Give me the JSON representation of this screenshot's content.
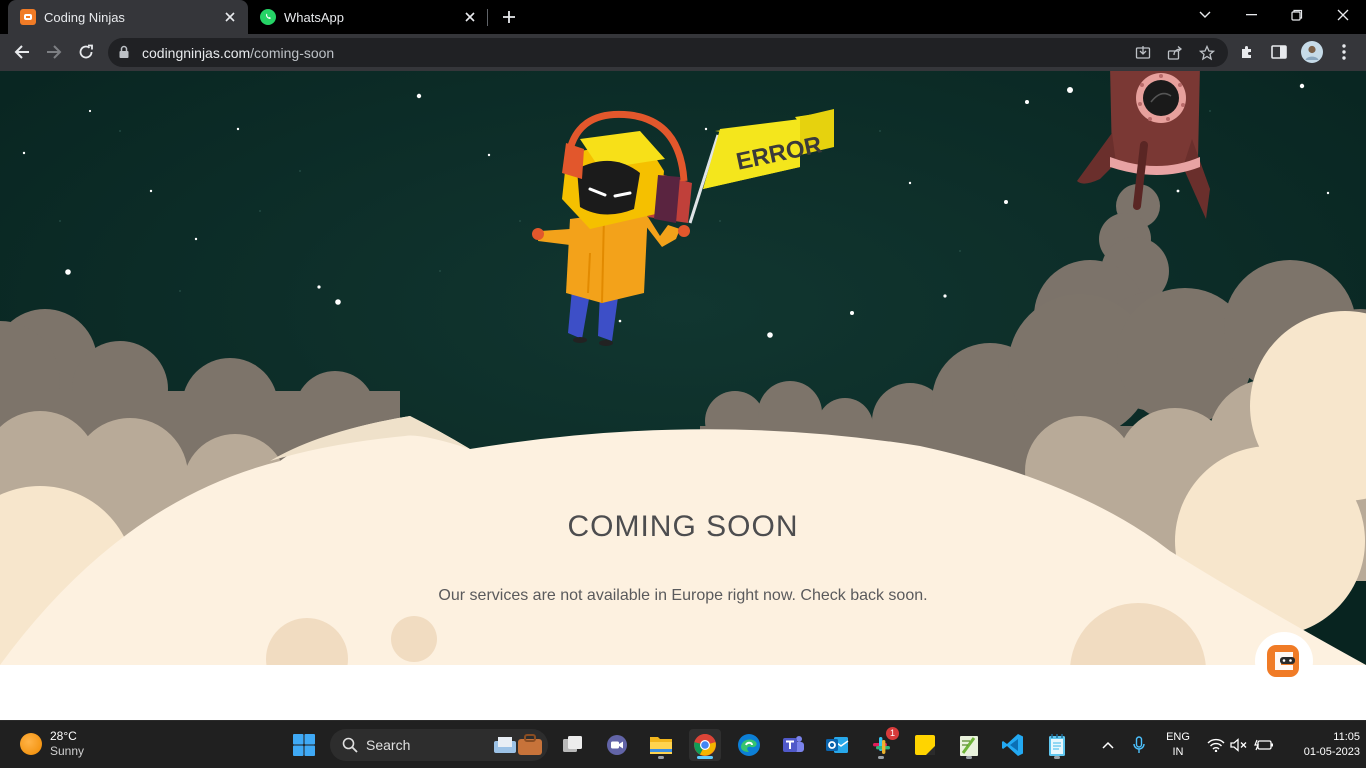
{
  "browser": {
    "tabs": [
      {
        "title": "Coding Ninjas",
        "active": true,
        "icon": "coding-ninjas-favicon"
      },
      {
        "title": "WhatsApp",
        "active": false,
        "icon": "whatsapp-favicon"
      }
    ],
    "address": {
      "host": "codingninjas.com",
      "path": "/coming-soon"
    }
  },
  "page": {
    "flag_text": "ERROR",
    "heading": "COMING SOON",
    "message": "Our services are not available in Europe right now. Check back soon.",
    "colors": {
      "sky": "#0d2a26",
      "moon": "#fdf1e0",
      "cloud_dark": "#7d746a",
      "cloud_light": "#b9ab99",
      "brand_orange": "#f07b26"
    }
  },
  "taskbar": {
    "weather": {
      "temp": "28°C",
      "condition": "Sunny"
    },
    "search_label": "Search",
    "slack_badge": "1",
    "language": {
      "line1": "ENG",
      "line2": "IN"
    },
    "clock": {
      "time": "11:05",
      "date": "01-05-2023"
    }
  }
}
